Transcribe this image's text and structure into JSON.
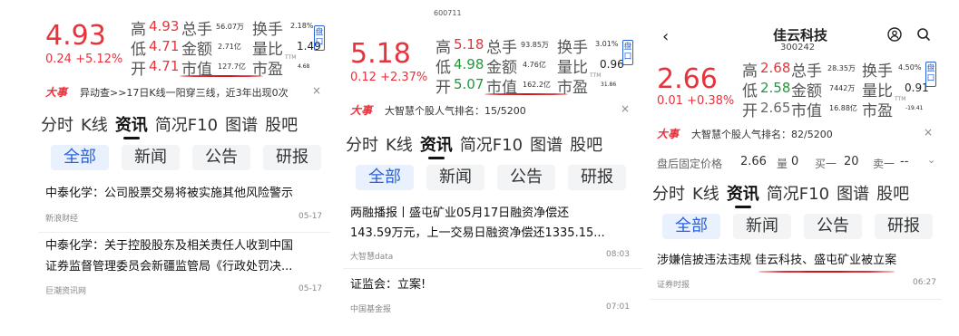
{
  "panel1": {
    "price": "4.93",
    "change": "0.24 +5.12%",
    "quote": {
      "high_label": "高",
      "high": "4.93",
      "low_label": "低",
      "low": "4.71",
      "open_label": "开",
      "open": "4.71",
      "vol_label": "总手",
      "vol": "56.07万",
      "amt_label": "金额",
      "amt": "2.71亿",
      "mcap_label": "市值",
      "mcap": "127.7亿",
      "turn_label": "换手",
      "turn": "2.18%",
      "vr_label": "量比",
      "vr": "1.49",
      "pe_label": "市盈",
      "pe_sup": "TTM",
      "pe": "4.68"
    },
    "side_tag": "盘口",
    "event_badge": "大事",
    "event_text": "异动查>>17日K线一阳穿三线，近3年出现0次",
    "close": "×",
    "tabs": [
      "分时",
      "K线",
      "资讯",
      "简况F10",
      "图谱",
      "股吧"
    ],
    "subtabs": [
      "全部",
      "新闻",
      "公告",
      "研报"
    ],
    "news": [
      {
        "title": "中泰化学：公司股票交易将被实施其他风险警示",
        "source": "新浪财经",
        "time": "05-17"
      },
      {
        "title_line1": "中泰化学：关于控股股东及相关责任人收到中国",
        "title_line2": "证券监督管理委员会新疆监管局《行政处罚决...",
        "source": "巨潮资讯网",
        "time": "05-17"
      }
    ]
  },
  "panel2": {
    "top_cut": "600711",
    "price": "5.18",
    "change": "0.12 +2.37%",
    "quote": {
      "high_label": "高",
      "high": "5.18",
      "low_label": "低",
      "low": "4.98",
      "open_label": "开",
      "open": "5.07",
      "vol_label": "总手",
      "vol": "93.85万",
      "amt_label": "金额",
      "amt": "4.76亿",
      "mcap_label": "市值",
      "mcap": "162.2亿",
      "turn_label": "换手",
      "turn": "3.01%",
      "vr_label": "量比",
      "vr": "0.96",
      "pe_label": "市盈",
      "pe_sup": "TTM",
      "pe": "31.86"
    },
    "side_tag": "盘口",
    "event_badge": "大事",
    "event_text": "大智慧个股人气排名：15/5200",
    "close": "×",
    "tabs": [
      "分时",
      "K线",
      "资讯",
      "简况F10",
      "图谱",
      "股吧"
    ],
    "subtabs": [
      "全部",
      "新闻",
      "公告",
      "研报"
    ],
    "news": [
      {
        "title_line1": "两融播报丨盛屯矿业05月17日融资净偿还",
        "title_line2": "143.59万元，上一交易日融资净偿还1335.15...",
        "source": "大智慧data",
        "time": "08:03"
      },
      {
        "title": "证监会：立案!",
        "source": "中国基金报",
        "time": "07:01"
      }
    ]
  },
  "panel3": {
    "nav_title": "佳云科技",
    "nav_code": "300242",
    "price": "2.66",
    "change": "0.01 +0.38%",
    "quote": {
      "high_label": "高",
      "high": "2.68",
      "low_label": "低",
      "low": "2.58",
      "open_label": "开",
      "open": "2.65",
      "vol_label": "总手",
      "vol": "28.35万",
      "amt_label": "金额",
      "amt": "7442万",
      "mcap_label": "市值",
      "mcap": "16.88亿",
      "turn_label": "换手",
      "turn": "4.50%",
      "vr_label": "量比",
      "vr": "0.91",
      "pe_label": "市盈",
      "pe_sup": "TTM",
      "pe": "-19.41"
    },
    "side_tag": "盘口",
    "event_badge": "大事",
    "event_text": "大智慧个股人气排名：82/5200",
    "close": "×",
    "after_hours": {
      "label": "盘后固定价格",
      "price": "2.66",
      "vol_label": "量",
      "vol": "0",
      "buy_label": "买一",
      "buy": "20",
      "sell_label": "卖一",
      "sell": "--"
    },
    "tabs": [
      "分时",
      "K线",
      "资讯",
      "简况F10",
      "图谱",
      "股吧"
    ],
    "subtabs": [
      "全部",
      "新闻",
      "公告",
      "研报"
    ],
    "news": [
      {
        "title": "涉嫌信披违法违规 佳云科技、盛屯矿业被立案",
        "source": "证券时报",
        "time": "06:27"
      }
    ]
  }
}
